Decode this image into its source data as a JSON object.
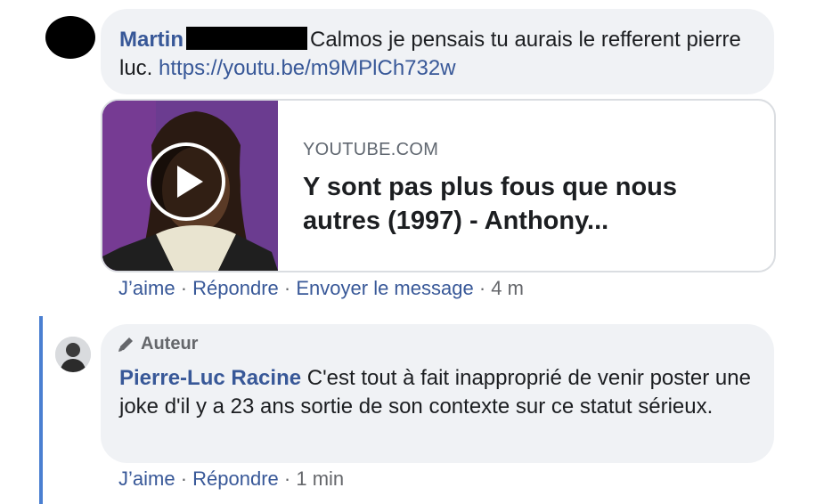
{
  "comment1": {
    "author": "Martin",
    "text": "Calmos je pensais tu aurais le refferent pierre luc.",
    "link": "https://youtu.be/m9MPlCh732w",
    "preview": {
      "domain": "YOUTUBE.COM",
      "title": "Y sont pas plus fous que nous autres (1997) - Anthony..."
    },
    "actions": {
      "like": "J’aime",
      "reply": "Répondre",
      "message": "Envoyer le message",
      "time": "4 m",
      "separator": "·"
    }
  },
  "comment2": {
    "badge": "Auteur",
    "author": "Pierre-Luc Racine",
    "text": "C'est tout à fait inapproprié de venir poster une joke d'il y a 23 ans sortie de son contexte sur ce statut sérieux.",
    "actions": {
      "like": "J’aime",
      "reply": "Répondre",
      "time": "1 min",
      "separator": "·"
    }
  },
  "icons": {
    "play": "play-icon",
    "badge": "pencil-icon"
  },
  "colors": {
    "link": "#385898",
    "bubble": "#f0f2f5",
    "thread_line": "#4a7fd1"
  }
}
